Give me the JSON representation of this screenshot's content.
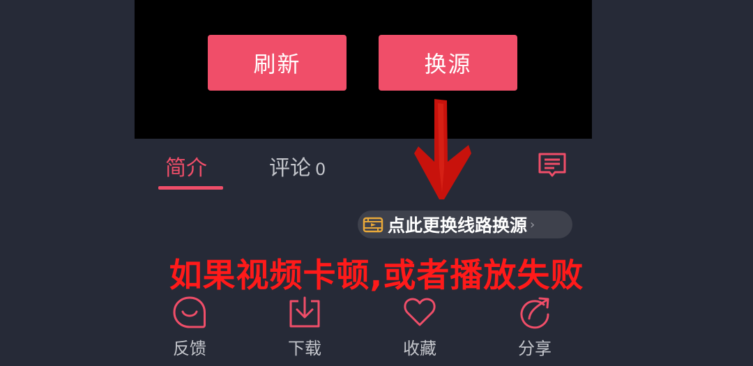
{
  "player": {
    "refresh_label": "刷新",
    "switch_source_label": "换源"
  },
  "tabs": [
    {
      "label": "简介",
      "active": true
    },
    {
      "label": "评论",
      "count": "0",
      "active": false
    }
  ],
  "source_pill": {
    "text": "点此更换线路换源",
    "caret": "›"
  },
  "notice": "如果视频卡顿,或者播放失败",
  "actions": [
    {
      "label": "反馈",
      "icon": "feedback-icon"
    },
    {
      "label": "下载",
      "icon": "download-icon"
    },
    {
      "label": "收藏",
      "icon": "heart-icon"
    },
    {
      "label": "分享",
      "icon": "share-icon"
    }
  ],
  "colors": {
    "accent": "#f04e69",
    "background": "#262a37",
    "notice_red": "#ff1a1a",
    "arrow_red": "#c8120c",
    "pill_icon": "#e9a93a"
  }
}
